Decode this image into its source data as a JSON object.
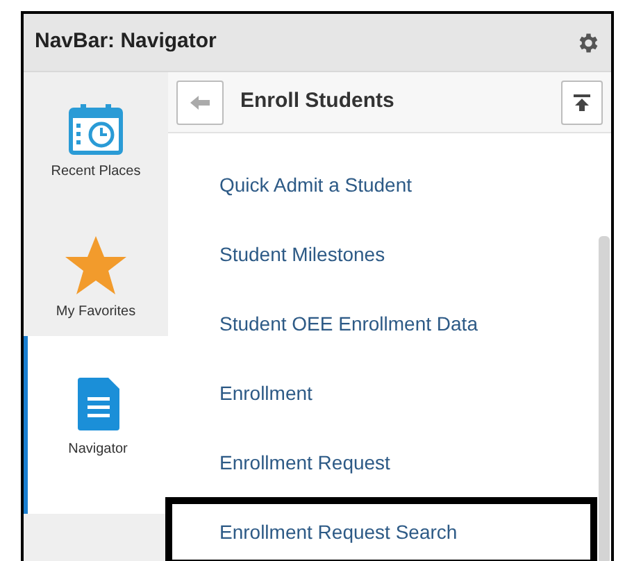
{
  "header": {
    "title": "NavBar: Navigator"
  },
  "sidebar": {
    "items": [
      {
        "kind": "recent",
        "label": "Recent Places",
        "selected": false
      },
      {
        "kind": "favorites",
        "label": "My Favorites",
        "selected": false
      },
      {
        "kind": "navigator",
        "label": "Navigator",
        "selected": true
      }
    ]
  },
  "panel": {
    "title": "Enroll Students"
  },
  "menu": {
    "items": [
      {
        "label": "Quick Admit a Student",
        "highlighted": false
      },
      {
        "label": "Student Milestones",
        "highlighted": false
      },
      {
        "label": "Student OEE Enrollment Data",
        "highlighted": false
      },
      {
        "label": "Enrollment",
        "highlighted": false
      },
      {
        "label": "Enrollment Request",
        "highlighted": false
      },
      {
        "label": "Enrollment Request Search",
        "highlighted": true
      }
    ]
  }
}
